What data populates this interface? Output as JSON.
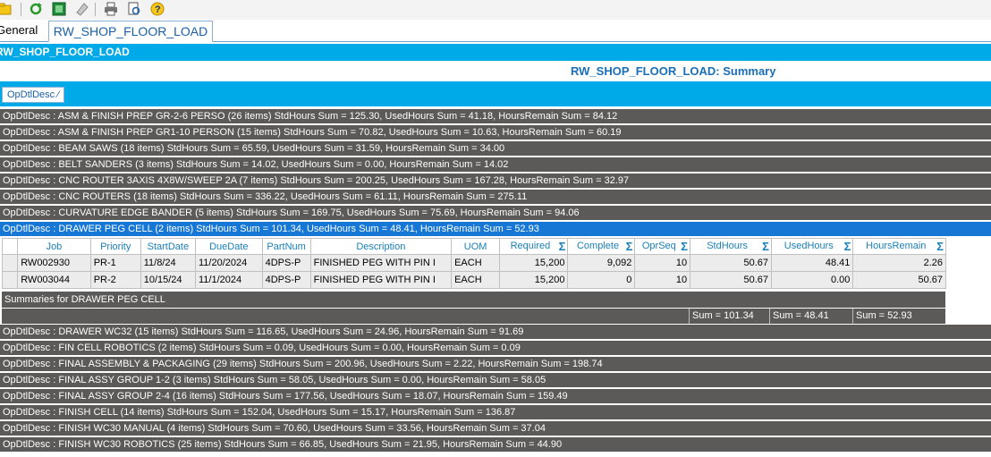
{
  "toolbar": {
    "icons": [
      "folder-icon",
      "refresh-icon",
      "excel-icon",
      "eraser-icon",
      "print-icon",
      "print-preview-icon",
      "help-icon"
    ]
  },
  "tabs": {
    "general": "General",
    "active": "RW_SHOP_FLOOR_LOAD"
  },
  "title_bar": "RW_SHOP_FLOOR_LOAD",
  "summary_title": "RW_SHOP_FLOOR_LOAD:  Summary",
  "group_chip": "OpDtlDesc ⁄",
  "groups_before": [
    "OpDtlDesc : ASM & FINISH PREP GR-2-6 PERSO (26 items) StdHours Sum = 125.30, UsedHours Sum = 41.18, HoursRemain Sum = 84.12",
    "OpDtlDesc : ASM & FINISH PREP GR1-10 PERSON (15 items) StdHours Sum = 70.82, UsedHours Sum = 10.63, HoursRemain Sum = 60.19",
    "OpDtlDesc : BEAM SAWS (18 items) StdHours Sum = 65.59, UsedHours Sum = 31.59, HoursRemain Sum = 34.00",
    "OpDtlDesc : BELT SANDERS (3 items) StdHours Sum = 14.02, UsedHours Sum = 0.00, HoursRemain Sum = 14.02",
    "OpDtlDesc : CNC ROUTER 3AXIS 4X8W/SWEEP 2A (7 items) StdHours Sum = 200.25, UsedHours Sum = 167.28, HoursRemain Sum = 32.97",
    "OpDtlDesc : CNC ROUTERS (18 items) StdHours Sum = 336.22, UsedHours Sum = 61.11, HoursRemain Sum = 275.11",
    "OpDtlDesc : CURVATURE EDGE BANDER (5 items) StdHours Sum = 169.75, UsedHours Sum = 75.69, HoursRemain Sum = 94.06"
  ],
  "selected_group": "OpDtlDesc : DRAWER PEG CELL (2 items) StdHours Sum = 101.34, UsedHours Sum = 48.41, HoursRemain Sum = 52.93",
  "columns": [
    "Job",
    "Priority",
    "StartDate",
    "DueDate",
    "PartNum",
    "Description",
    "UOM",
    "Required",
    "Complete",
    "OprSeq",
    "StdHours",
    "UsedHours",
    "HoursRemain"
  ],
  "rows": [
    [
      "RW002930",
      "PR-1",
      "11/8/24",
      "11/20/2024",
      "4DPS-P",
      "FINISHED PEG WITH PIN I",
      "EACH",
      "15,200",
      "9,092",
      "10",
      "50.67",
      "48.41",
      "2.26"
    ],
    [
      "RW003044",
      "PR-2",
      "10/15/24",
      "11/1/2024",
      "4DPS-P",
      "FINISHED PEG WITH PIN I",
      "EACH",
      "15,200",
      "0",
      "10",
      "50.67",
      "0.00",
      "50.67"
    ]
  ],
  "summaries_label": "Summaries for DRAWER PEG CELL",
  "sums": {
    "std": "Sum = 101.34",
    "used": "Sum = 48.41",
    "remain": "Sum = 52.93"
  },
  "groups_after": [
    "OpDtlDesc : DRAWER WC32 (15 items) StdHours Sum = 116.65, UsedHours Sum = 24.96, HoursRemain Sum = 91.69",
    "OpDtlDesc : FIN CELL ROBOTICS (2 items) StdHours Sum = 0.09, UsedHours Sum = 0.00, HoursRemain Sum = 0.09",
    "OpDtlDesc : FINAL ASSEMBLY & PACKAGING (29 items) StdHours Sum = 200.96, UsedHours Sum = 2.22, HoursRemain Sum = 198.74",
    "OpDtlDesc : FINAL ASSY GROUP 1-2 (3 items) StdHours Sum = 58.05, UsedHours Sum = 0.00, HoursRemain Sum = 58.05",
    "OpDtlDesc : FINAL ASSY GROUP 2-4 (16 items) StdHours Sum = 177.56, UsedHours Sum = 18.07, HoursRemain Sum = 159.49",
    "OpDtlDesc : FINISH CELL (14 items) StdHours Sum = 152.04, UsedHours Sum = 15.17, HoursRemain Sum = 136.87",
    "OpDtlDesc : FINISH WC30 MANUAL (4 items) StdHours Sum = 70.60, UsedHours Sum = 33.56, HoursRemain Sum = 37.04",
    "OpDtlDesc : FINISH WC30 ROBOTICS (25 items) StdHours Sum = 66.85, UsedHours Sum = 21.95, HoursRemain Sum = 44.90"
  ],
  "colors": {
    "accent": "#00a9e7",
    "group_row": "#5c5a58",
    "selected_row": "#1677d4",
    "header_text": "#1a7fb8"
  }
}
